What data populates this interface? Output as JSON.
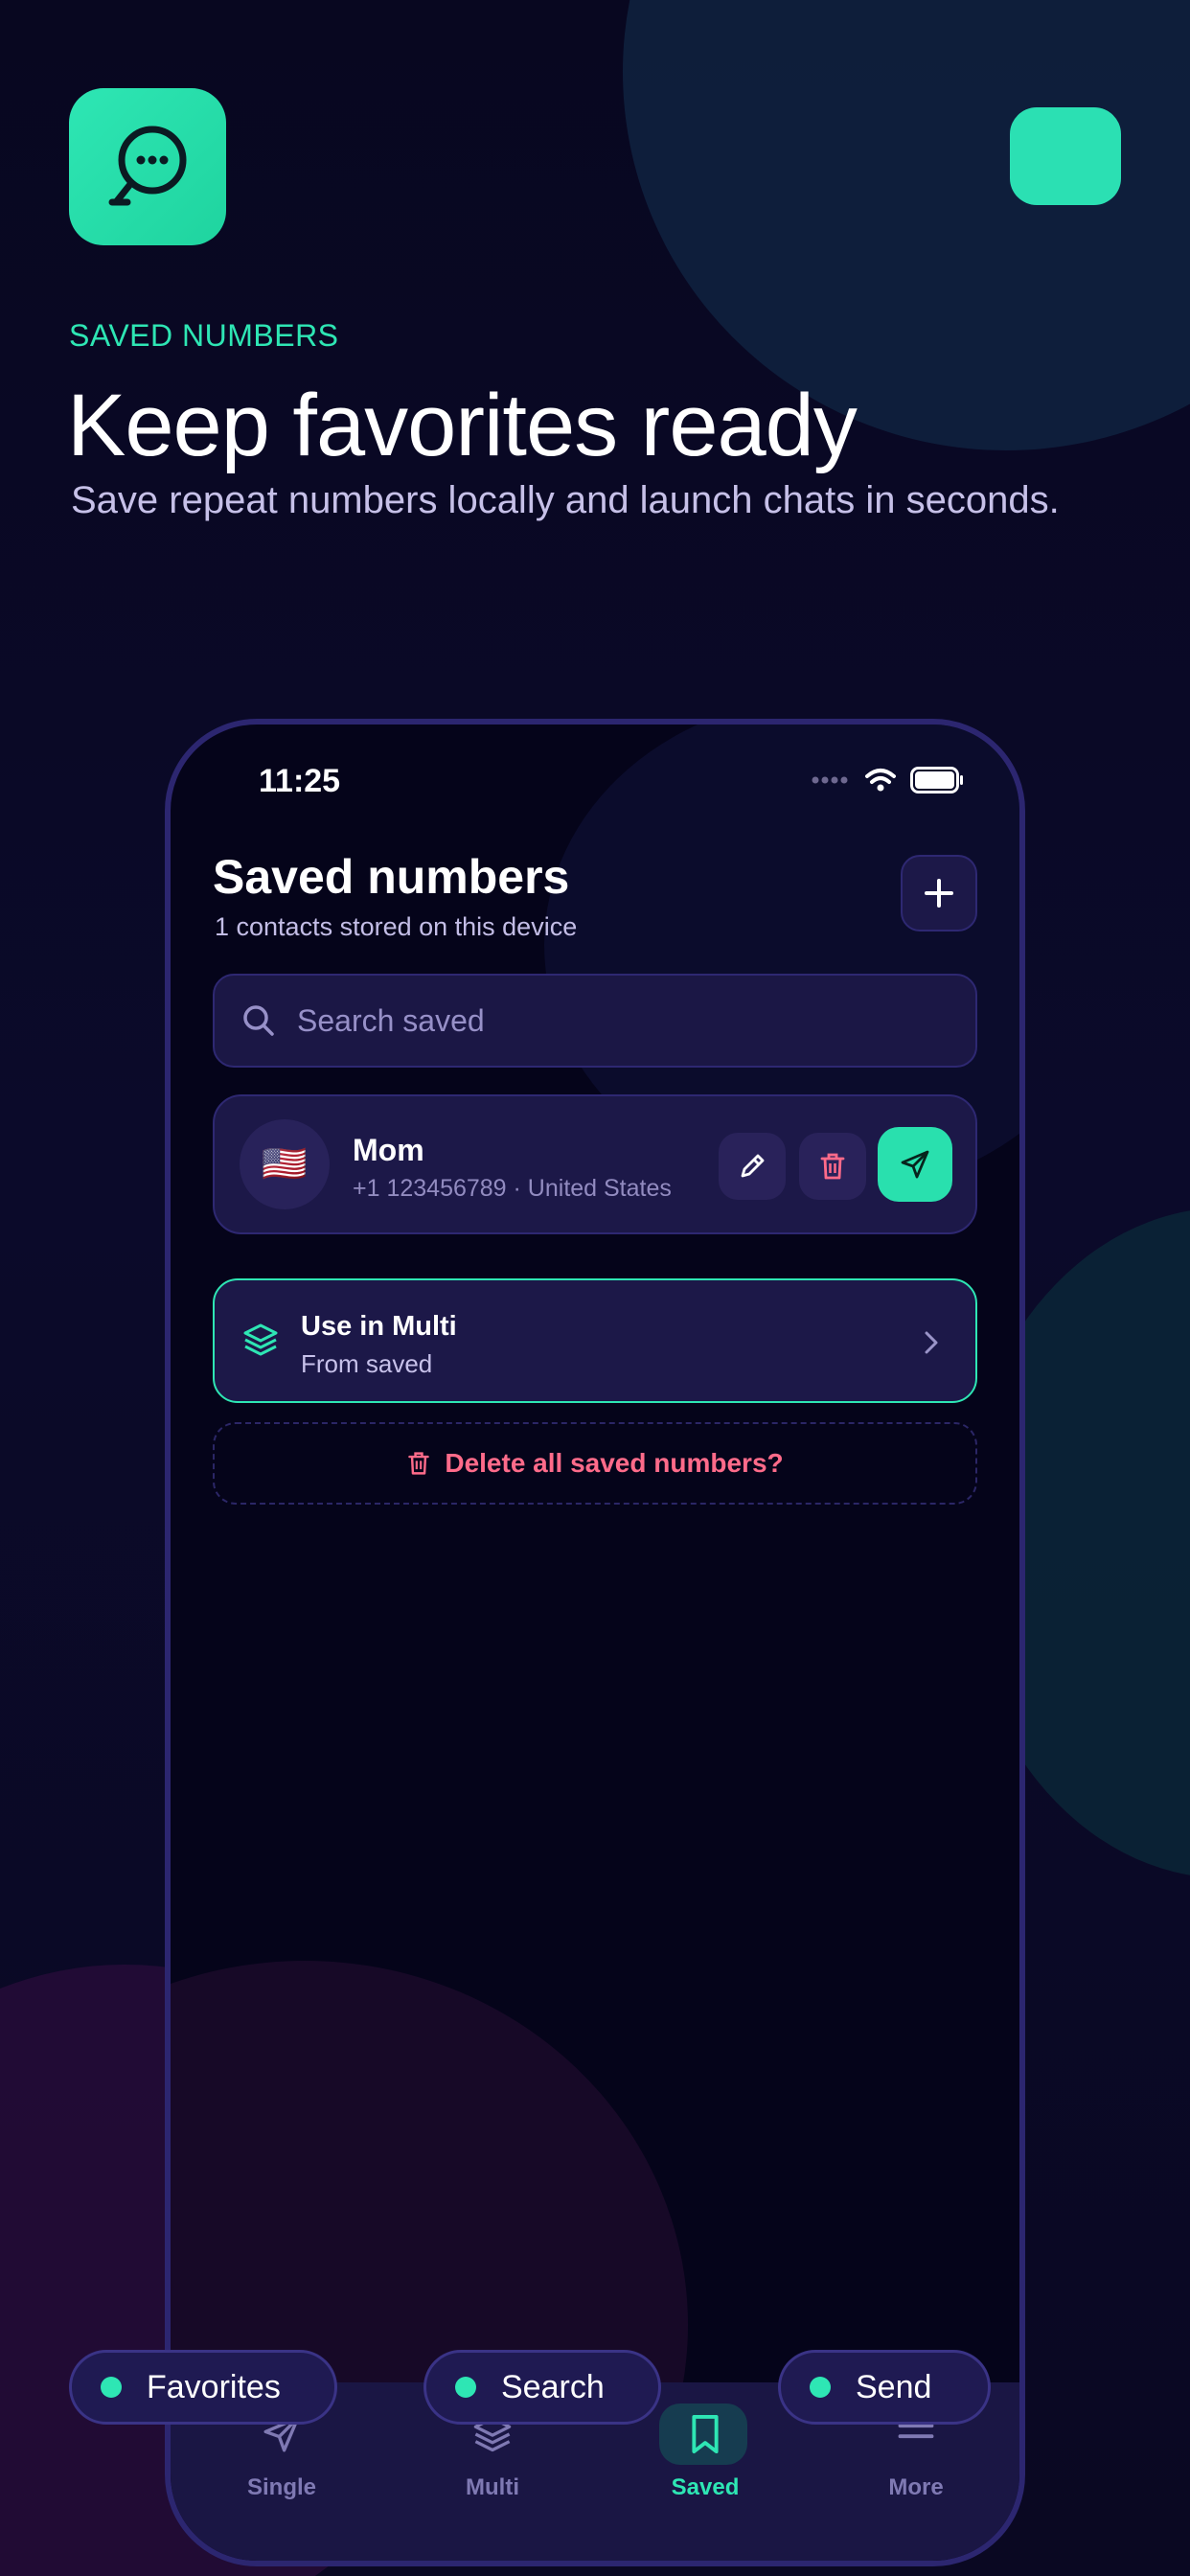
{
  "promo": {
    "eyebrow": "SAVED NUMBERS",
    "headline": "Keep favorites ready",
    "subhead": "Save repeat numbers locally and launch chats in seconds.",
    "accent_color": "#2EE6B4",
    "app_icon": "chat-bubble-icon"
  },
  "status": {
    "time": "11:25",
    "icons": [
      "signal-icon",
      "wifi-icon",
      "battery-icon"
    ]
  },
  "screen": {
    "title": "Saved numbers",
    "subtitle": "1 contacts stored on this device",
    "add_icon": "plus-icon"
  },
  "search": {
    "placeholder": "Search saved",
    "icon": "search-icon"
  },
  "contacts": [
    {
      "flag": "🇺🇸",
      "name": "Mom",
      "meta": "+1 123456789 · United States",
      "actions": [
        "pencil-icon",
        "trash-icon",
        "send-icon"
      ]
    }
  ],
  "multi": {
    "title": "Use in Multi",
    "subtitle": "From saved",
    "icon": "layers-icon"
  },
  "delete_all": {
    "label": "Delete all saved numbers?",
    "color": "#FF6B8A"
  },
  "tabs": [
    {
      "label": "Single",
      "icon": "send-icon"
    },
    {
      "label": "Multi",
      "icon": "layers-icon"
    },
    {
      "label": "Saved",
      "icon": "bookmark-icon",
      "active": true
    },
    {
      "label": "More",
      "icon": "menu-icon"
    }
  ],
  "chips": [
    "Favorites",
    "Search",
    "Send"
  ]
}
